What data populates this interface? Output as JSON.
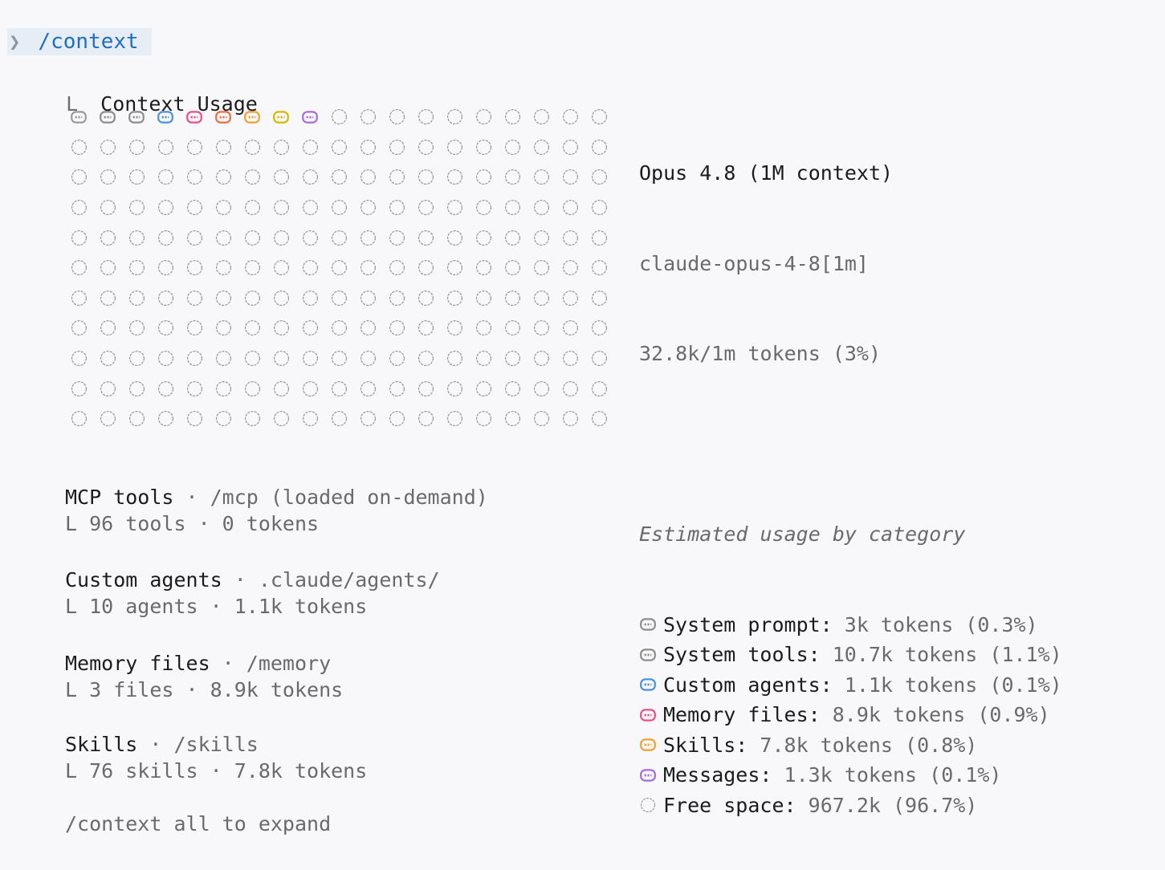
{
  "prompt": {
    "chevron": "❯",
    "command": "/context"
  },
  "header": {
    "tree_glyph": "L",
    "title": "Context Usage"
  },
  "grid": {
    "rows": 11,
    "cols": 19,
    "filled_cells": [
      {
        "category": "system-prompt",
        "color": "#9a9a9a"
      },
      {
        "category": "system-tools",
        "color": "#8c8c8c"
      },
      {
        "category": "system-tools",
        "color": "#8c8c8c"
      },
      {
        "category": "custom-agents",
        "color": "#4a90e2"
      },
      {
        "category": "memory-files",
        "color": "#e8508a"
      },
      {
        "category": "memory-files",
        "color": "#f06a3c"
      },
      {
        "category": "skills",
        "color": "#f0a030"
      },
      {
        "category": "skills",
        "color": "#d6b800"
      },
      {
        "category": "messages",
        "color": "#a66ae0"
      }
    ],
    "empty_color": "#9a9a9a"
  },
  "model": {
    "name": "Opus 4.8 (1M context)",
    "id": "claude-opus-4-8[1m]",
    "tokens": "32.8k/1m tokens (3%)"
  },
  "usage": {
    "heading": "Estimated usage by category",
    "categories": [
      {
        "label": "System prompt:",
        "value": "3k tokens (0.3%)",
        "icon": "system-prompt-icon",
        "color": "#8c8c8c"
      },
      {
        "label": "System tools:",
        "value": "10.7k tokens (1.1%)",
        "icon": "system-tools-icon",
        "color": "#8c8c8c"
      },
      {
        "label": "Custom agents:",
        "value": "1.1k tokens (0.1%)",
        "icon": "custom-agents-icon",
        "color": "#4a90e2"
      },
      {
        "label": "Memory files:",
        "value": "8.9k tokens (0.9%)",
        "icon": "memory-files-icon",
        "color": "#e8508a"
      },
      {
        "label": "Skills:",
        "value": "7.8k tokens (0.8%)",
        "icon": "skills-icon",
        "color": "#f0a030"
      },
      {
        "label": "Messages:",
        "value": "1.3k tokens (0.1%)",
        "icon": "messages-icon",
        "color": "#a66ae0"
      },
      {
        "label": "Free space:",
        "value": "967.2k (96.7%)",
        "icon": "free-space-icon",
        "color": "#9a9a9a"
      }
    ]
  },
  "sections": [
    {
      "title": "MCP tools",
      "sep": " · ",
      "path": "/mcp (loaded on-demand)",
      "sub": "L 96 tools · 0 tokens"
    },
    {
      "title": "Custom agents",
      "sep": " · ",
      "path": ".claude/agents/",
      "sub": "L 10 agents · 1.1k tokens"
    },
    {
      "title": "Memory files",
      "sep": " · ",
      "path": "/memory",
      "sub": "L 3 files · 8.9k tokens"
    },
    {
      "title": "Skills",
      "sep": " · ",
      "path": "/skills",
      "sub": "L 76 skills · 7.8k tokens"
    }
  ],
  "footer": "/context all to expand"
}
